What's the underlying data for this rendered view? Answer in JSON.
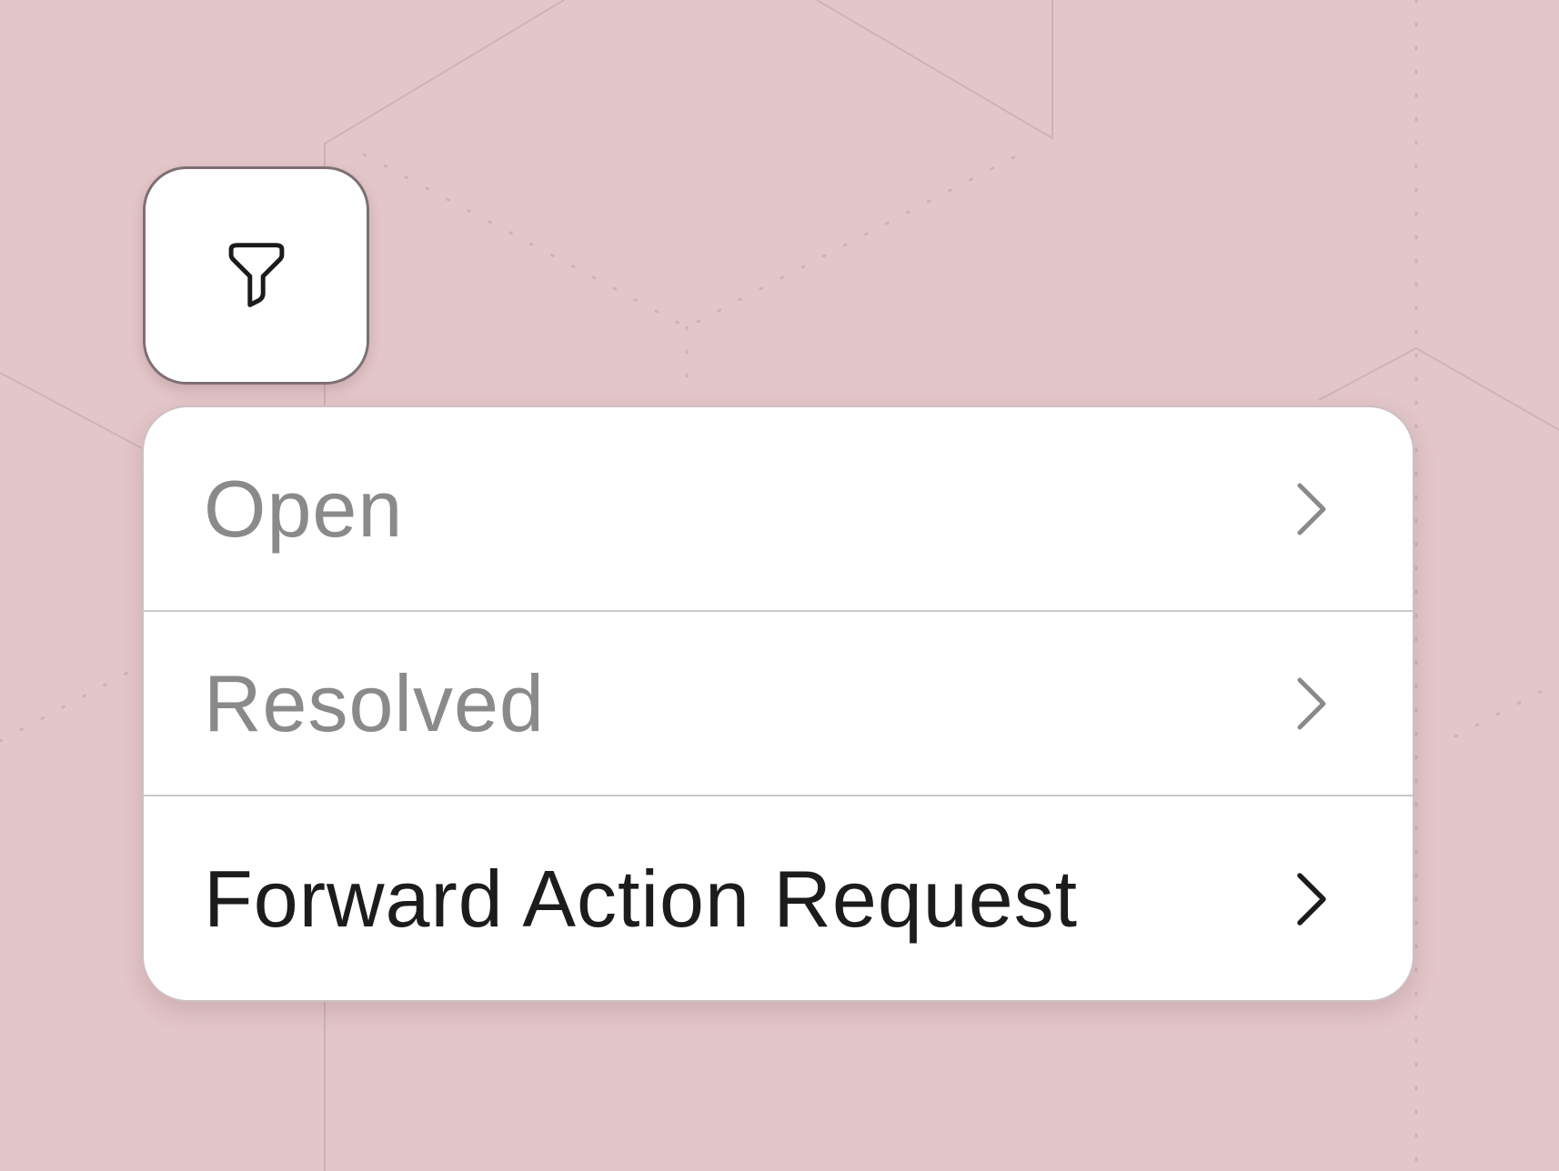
{
  "filter_button": {
    "icon": "filter-funnel-icon"
  },
  "menu": {
    "items": [
      {
        "label": "Open",
        "state": "muted",
        "icon": "chevron-right-icon",
        "color": "#8a8a8a"
      },
      {
        "label": "Resolved",
        "state": "muted",
        "icon": "chevron-right-icon",
        "color": "#8a8a8a"
      },
      {
        "label": "Forward Action Request",
        "state": "active",
        "icon": "chevron-right-icon",
        "color": "#1c1c1c"
      }
    ]
  },
  "colors": {
    "background": "#e3c6c9",
    "card": "#ffffff",
    "divider": "#c9c9c9",
    "button_border": "#7d6f74"
  }
}
